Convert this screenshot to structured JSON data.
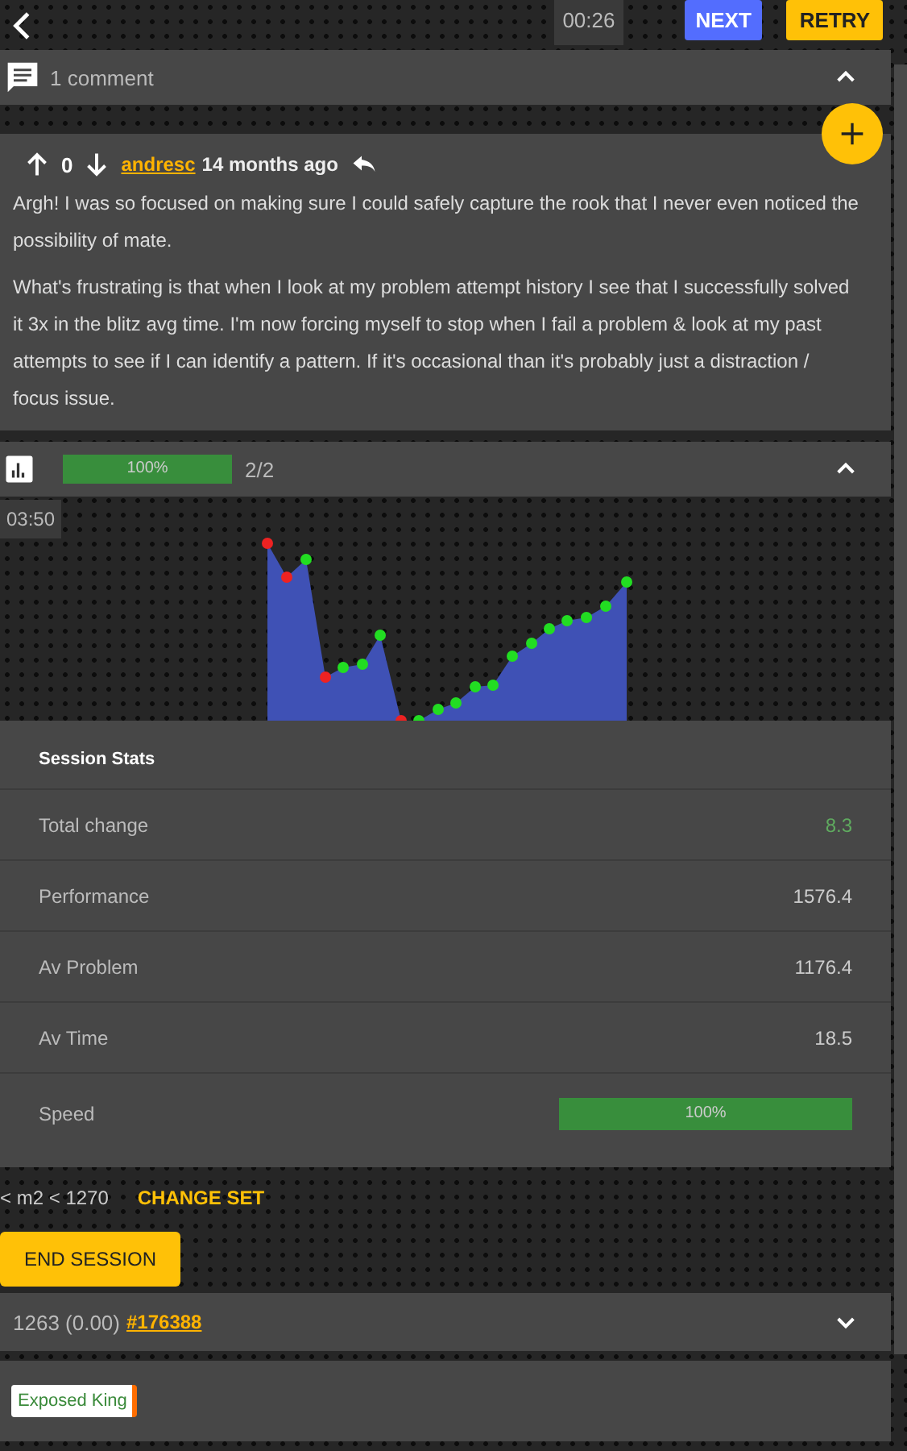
{
  "top_bar": {
    "timer": "00:26",
    "buttons": [
      {
        "label": "NEXT",
        "kind": "primary"
      },
      {
        "label": "RETRY",
        "kind": "accent"
      }
    ]
  },
  "comments": {
    "header": "1 comment",
    "expanded": true,
    "items": [
      {
        "score": "0",
        "author": "andresc",
        "age": "14 months ago",
        "paragraphs": [
          "Argh! I was so focused on making sure I could safely capture the rook that I never even noticed the possibility of mate.",
          "What's frustrating is that when I look at my problem attempt history I see that I successfully solved it 3x in the blitz avg time. I'm now forcing myself to stop when I fail a problem & look at my past attempts to see if I can identify a pattern. If it's occasional than it's probably just a distraction / focus issue."
        ]
      }
    ]
  },
  "progress": {
    "level": 1,
    "label": "100%",
    "count": "2/2",
    "expanded": true,
    "timer": "03:50"
  },
  "session_stats": {
    "title": "Session Stats",
    "rows": [
      {
        "label": "Total change",
        "value": "8.3",
        "kind": "positive"
      },
      {
        "label": "Performance",
        "value": "1576.4",
        "kind": "text"
      },
      {
        "label": "Av Problem",
        "value": "1176.4",
        "kind": "text"
      },
      {
        "label": "Av Time",
        "value": "18.5",
        "kind": "text"
      },
      {
        "label": "Speed",
        "kind": "meter",
        "level": 1,
        "reading": "100%"
      }
    ]
  },
  "filter": {
    "range": "< m2 < 1270",
    "action": "CHANGE SET"
  },
  "end_button": "END SESSION",
  "problem": {
    "rating": "1263 (0.00)",
    "link": "#176388",
    "expanded": false
  },
  "tags": [
    {
      "label": "Exposed King"
    }
  ]
}
